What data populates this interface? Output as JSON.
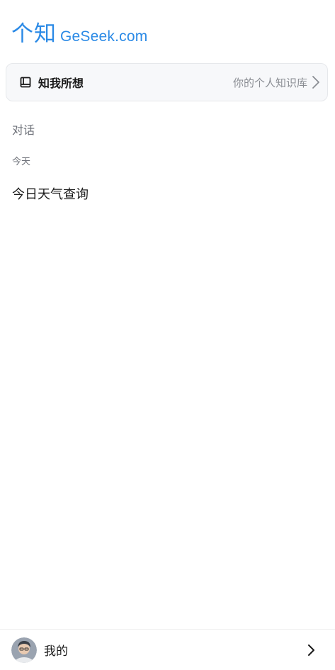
{
  "header": {
    "logo_cn": "个知",
    "logo_en": "GeSeek.com"
  },
  "knowledge_base": {
    "icon": "book-icon",
    "title": "知我所想",
    "subtitle": "你的个人知识库",
    "chevron_icon": "chevron-right-icon"
  },
  "conversations": {
    "section_label": "对话",
    "groups": [
      {
        "label": "今天",
        "items": [
          {
            "title": "今日天气查询"
          }
        ]
      }
    ]
  },
  "footer": {
    "avatar_icon": "user-avatar",
    "label": "我的",
    "chevron_icon": "chevron-right-icon"
  },
  "colors": {
    "brand": "#2b8ae6",
    "card_background": "#f7f8fa",
    "muted_text": "#6d7078"
  }
}
